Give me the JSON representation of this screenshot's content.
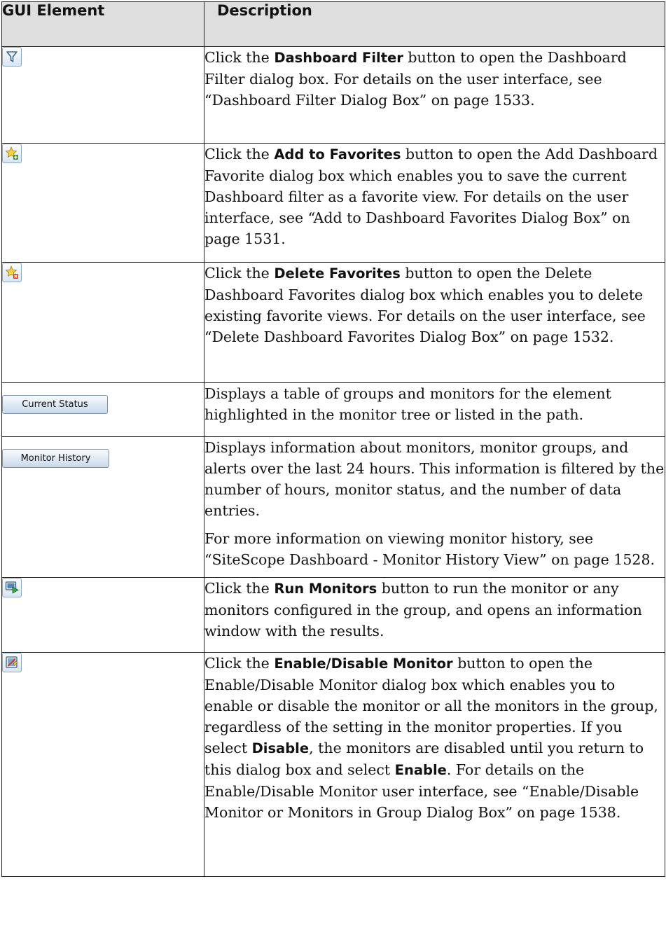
{
  "table": {
    "headers": {
      "gui_element": "GUI Element",
      "description": "Description"
    },
    "rows": [
      {
        "icon": "filter-icon",
        "text_before": "Click the ",
        "bold": "Dashboard Filter",
        "text_after": " button to open the Dashboard Filter dialog box. For details on the user interface, see “Dashboard Filter Dialog Box” on page 1533."
      },
      {
        "icon": "add-favorite-star-icon",
        "text_before": "Click the ",
        "bold": "Add to Favorites",
        "text_after": " button to open the Add Dashboard Favorite dialog box which enables you to save the current Dashboard filter as a favorite view. For details on the user interface, see “Add to Dashboard Favorites Dialog Box” on page 1531."
      },
      {
        "icon": "delete-favorite-star-icon",
        "text_before": "Click the ",
        "bold": "Delete Favorites",
        "text_after": " button to open the Delete Dashboard Favorites dialog box which enables you to delete existing favorite views. For details on the user interface, see “Delete Dashboard Favorites Dialog Box” on page 1532."
      },
      {
        "button_label": "Current Status",
        "text": "Displays a table of groups and monitors for the element highlighted in the monitor tree or listed in the path."
      },
      {
        "button_label": "Monitor History",
        "text": "Displays information about monitors, monitor groups, and alerts over the last 24 hours. This information is filtered by the number of hours, monitor status, and the number of data entries.",
        "text_2": "For more information on viewing monitor history, see “SiteScope Dashboard - Monitor History View” on page 1528."
      },
      {
        "icon": "run-monitors-icon",
        "text_before": "Click the ",
        "bold": "Run Monitors",
        "text_after": " button to run the monitor or any monitors configured in the group, and opens an information window with the results."
      },
      {
        "icon": "enable-disable-monitor-icon",
        "text_before": "Click the ",
        "bold": "Enable/Disable Monitor",
        "text_mid1": " button to open the Enable/Disable Monitor dialog box which enables you to enable or disable the monitor or all the monitors in the group, regardless of the setting in the monitor properties. If you select ",
        "bold_2": "Disable",
        "text_mid2": ", the monitors are disabled until you return to this dialog box and select ",
        "bold_3": "Enable",
        "text_after": ". For details on the Enable/Disable Monitor user interface, see “Enable/Disable Monitor or Monitors in Group Dialog Box” on page 1538."
      }
    ]
  }
}
